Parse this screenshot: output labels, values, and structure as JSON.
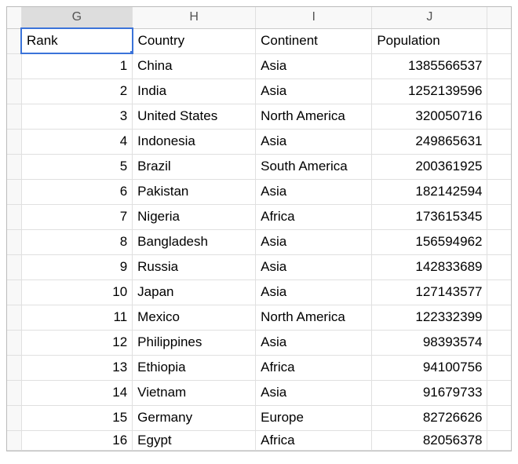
{
  "columns": {
    "g": "G",
    "h": "H",
    "i": "I",
    "j": "J"
  },
  "headers": {
    "rank": "Rank",
    "country": "Country",
    "continent": "Continent",
    "population": "Population"
  },
  "rows": [
    {
      "rank": "1",
      "country": "China",
      "continent": "Asia",
      "population": "1385566537"
    },
    {
      "rank": "2",
      "country": "India",
      "continent": "Asia",
      "population": "1252139596"
    },
    {
      "rank": "3",
      "country": "United States",
      "continent": "North America",
      "population": "320050716"
    },
    {
      "rank": "4",
      "country": "Indonesia",
      "continent": "Asia",
      "population": "249865631"
    },
    {
      "rank": "5",
      "country": "Brazil",
      "continent": "South America",
      "population": "200361925"
    },
    {
      "rank": "6",
      "country": "Pakistan",
      "continent": "Asia",
      "population": "182142594"
    },
    {
      "rank": "7",
      "country": "Nigeria",
      "continent": "Africa",
      "population": "173615345"
    },
    {
      "rank": "8",
      "country": "Bangladesh",
      "continent": "Asia",
      "population": "156594962"
    },
    {
      "rank": "9",
      "country": "Russia",
      "continent": "Asia",
      "population": "142833689"
    },
    {
      "rank": "10",
      "country": "Japan",
      "continent": "Asia",
      "population": "127143577"
    },
    {
      "rank": "11",
      "country": "Mexico",
      "continent": "North America",
      "population": "122332399"
    },
    {
      "rank": "12",
      "country": "Philippines",
      "continent": "Asia",
      "population": "98393574"
    },
    {
      "rank": "13",
      "country": "Ethiopia",
      "continent": "Africa",
      "population": "94100756"
    },
    {
      "rank": "14",
      "country": "Vietnam",
      "continent": "Asia",
      "population": "91679733"
    },
    {
      "rank": "15",
      "country": "Germany",
      "continent": "Europe",
      "population": "82726626"
    },
    {
      "rank": "16",
      "country": "Egypt",
      "continent": "Africa",
      "population": "82056378"
    }
  ]
}
